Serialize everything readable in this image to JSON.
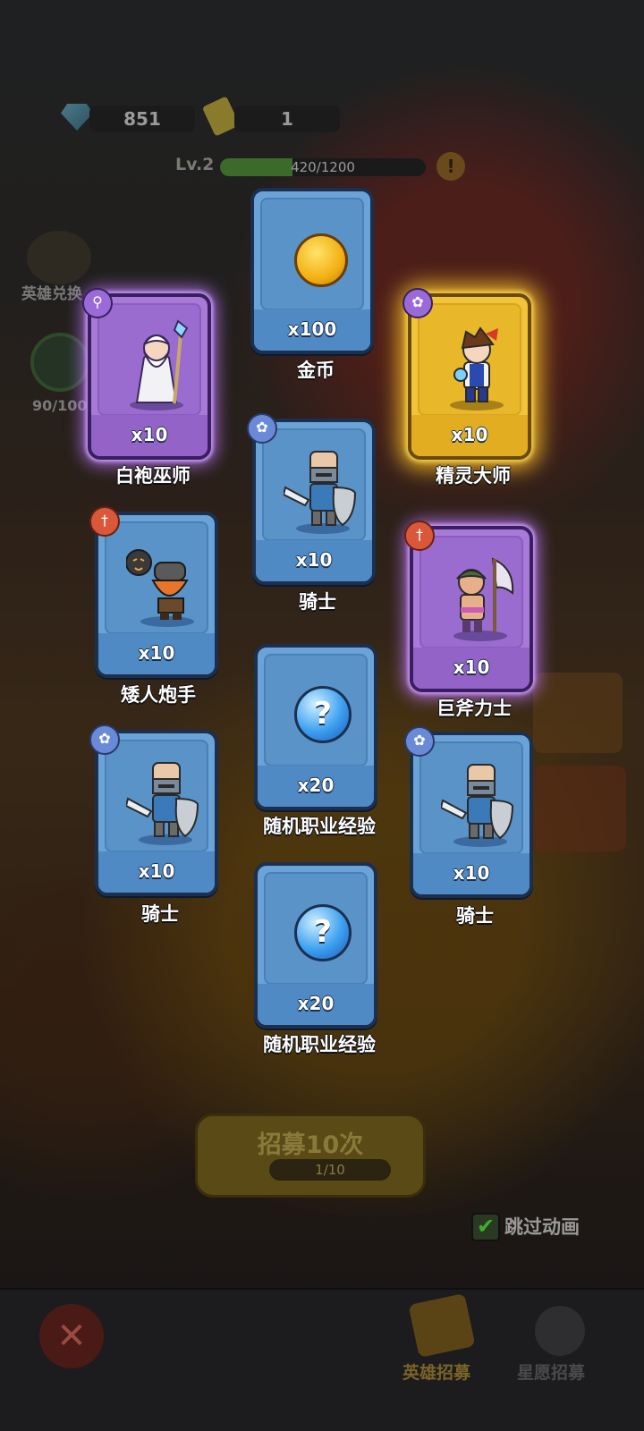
{
  "topbar": {
    "gem_count": "851",
    "ticket_count": "1",
    "level": "Lv.2",
    "xp_text": "420/1200",
    "xp_progress": 0.35,
    "warn_symbol": "!",
    "side_label_1": "英雄兑换",
    "side_label_2": "90/100"
  },
  "cards": [
    {
      "id": "gold",
      "qty": "x100",
      "label": "金币",
      "rarity": "blue",
      "badge": null,
      "icon": "gold-coin-icon"
    },
    {
      "id": "white-mage",
      "qty": "x10",
      "label": "白袍巫师",
      "rarity": "purple",
      "badge": "staff-class-icon",
      "icon": "white-mage-portrait"
    },
    {
      "id": "elf-master",
      "qty": "x10",
      "label": "精灵大师",
      "rarity": "gold",
      "badge": "paw-class-icon",
      "icon": "elf-master-portrait"
    },
    {
      "id": "knight-1",
      "qty": "x10",
      "label": "骑士",
      "rarity": "blue",
      "badge": "paw-class-icon",
      "icon": "knight-portrait"
    },
    {
      "id": "dwarf-gunner",
      "qty": "x10",
      "label": "矮人炮手",
      "rarity": "blue",
      "badge": "sword-class-icon",
      "icon": "dwarf-gunner-portrait"
    },
    {
      "id": "axe-warrior",
      "qty": "x10",
      "label": "巨斧力士",
      "rarity": "purple",
      "badge": "sword-class-icon",
      "icon": "axe-warrior-portrait"
    },
    {
      "id": "exp-1",
      "qty": "x20",
      "label": "随机职业经验",
      "rarity": "blue",
      "badge": null,
      "icon": "mystery-orb-icon"
    },
    {
      "id": "knight-2",
      "qty": "x10",
      "label": "骑士",
      "rarity": "blue",
      "badge": "paw-class-icon",
      "icon": "knight-portrait"
    },
    {
      "id": "knight-3",
      "qty": "x10",
      "label": "骑士",
      "rarity": "blue",
      "badge": "paw-class-icon",
      "icon": "knight-portrait"
    },
    {
      "id": "exp-2",
      "qty": "x20",
      "label": "随机职业经验",
      "rarity": "blue",
      "badge": null,
      "icon": "mystery-orb-icon"
    }
  ],
  "orb_symbol": "?",
  "recruit": {
    "label": "招募10次",
    "progress": "1/10"
  },
  "skip": {
    "check": "✔",
    "label": "跳过动画"
  },
  "nav": {
    "close_symbol": "✕",
    "hero_recruit": "英雄招募",
    "wish_recruit": "星愿招募"
  },
  "colors": {
    "blue_card": "#6aa3d8",
    "purple_card": "#a77ad8",
    "gold_card": "#f2c43a",
    "xp_fill": "#3c6a2a"
  }
}
